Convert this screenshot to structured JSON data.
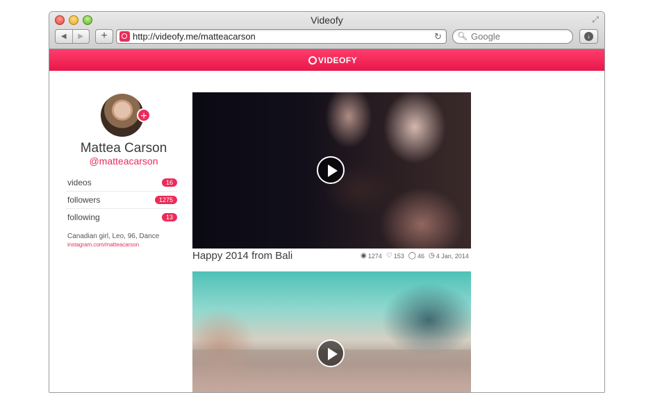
{
  "browser": {
    "title": "Videofy",
    "url": "http://videofy.me/matteacarson",
    "search_placeholder": "Google",
    "back_glyph": "◀",
    "forward_glyph": "▶",
    "new_tab_glyph": "+",
    "reload_glyph": "↻",
    "download_glyph": "↓",
    "fullscreen_glyph": "⤢"
  },
  "site": {
    "brand": "VIDEOFY",
    "brand_color": "#ec2b59"
  },
  "profile": {
    "name": "Mattea Carson",
    "handle": "@matteacarson",
    "follow_glyph": "+",
    "stats": [
      {
        "label": "videos",
        "count": "16"
      },
      {
        "label": "followers",
        "count": "1275"
      },
      {
        "label": "following",
        "count": "13"
      }
    ],
    "bio": "Canadian girl, Leo, 96, Dance",
    "link": "instagram.com/matteacarson"
  },
  "videos": [
    {
      "title": "Happy 2014 from Bali",
      "views": "1274",
      "likes": "153",
      "comments": "46",
      "date": "4 Jan, 2014"
    }
  ],
  "icons": {
    "views": "eye-icon",
    "likes": "heart-icon",
    "comments": "comment-icon",
    "date": "clock-icon",
    "search": "magnifier-icon",
    "play": "play-icon"
  }
}
